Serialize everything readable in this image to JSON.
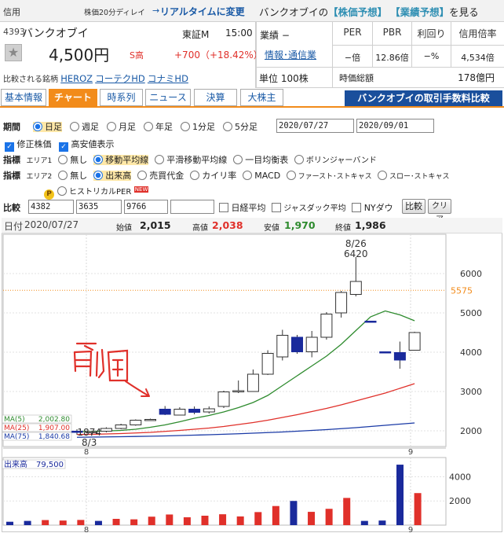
{
  "topbar": {
    "credit_label": "信用",
    "delay_text": "株価20分ディレイ",
    "arrow": "→",
    "realtime_link": "リアルタイムに変更",
    "predict_prefix": "バンクオブイの",
    "stock_forecast": "【株価予想】",
    "earnings_forecast": "【業績予想】",
    "predict_suffix": "を見る"
  },
  "stock": {
    "code": "4393",
    "name": "バンクオブイ",
    "market": "東証M",
    "time": "15:00",
    "price": "4,500円",
    "s_high": "S高",
    "change": "+700（+18.42%）",
    "star_icon": "★",
    "sector_label": "業績 −",
    "sector_link": "情報･通信業",
    "unit": "単位 100株",
    "compare_label": "比較される銘柄",
    "compare_links": [
      "HEROZ",
      "コーテクHD",
      "コナミHD"
    ]
  },
  "metrics": {
    "headers": [
      "PER",
      "PBR",
      "利回り",
      "信用倍率"
    ],
    "values": [
      "−倍",
      "12.86倍",
      "−%",
      "4,534倍"
    ],
    "mcap_label": "時価総額",
    "mcap_value": "178億円"
  },
  "tabs": [
    "基本情報",
    "チャート",
    "時系列",
    "ニュース",
    "決算",
    "大株主"
  ],
  "fee_banner": "バンクオブイの取引手数料比較",
  "controls": {
    "period_label": "期間",
    "periods": [
      "日足",
      "週足",
      "月足",
      "年足",
      "1分足",
      "5分足"
    ],
    "date_from": "2020/07/27",
    "date_to": "2020/09/01",
    "adj_price": "修正株価",
    "high_low": "高安値表示",
    "indicator_label": "指標",
    "area1_label": "エリア1",
    "area1_options": [
      "無し",
      "移動平均線",
      "平滑移動平均線",
      "一目均衡表",
      "ボリンジャーバンド"
    ],
    "area2_label": "エリア2",
    "area2_options": [
      "無し",
      "出来高",
      "売買代金",
      "カイリ率",
      "MACD",
      "ファースト･ストキャス",
      "スロー･ストキャス"
    ],
    "historical_per": "ヒストリカルPER",
    "new_badge": "NEW",
    "p_badge": "P",
    "compare_label": "比較",
    "compare_codes": [
      "4382",
      "3635",
      "9766",
      ""
    ],
    "nikkei": "日経平均",
    "jasdaq": "ジャスダック平均",
    "ny_dow": "NYダウ",
    "compare_btn": "比較",
    "clear_btn": "クリア"
  },
  "chart_info": {
    "date_label": "日付",
    "date": "2020/07/27",
    "open_label": "始値",
    "open": "2,015",
    "high_label": "高値",
    "high": "2,038",
    "low_label": "安値",
    "low": "1,970",
    "close_label": "終値",
    "close": "1,986"
  },
  "chart_data": {
    "type": "candlestick",
    "x_ticks": [
      "8",
      "9"
    ],
    "price_ticks": [
      2000,
      3000,
      4000,
      5000,
      6000
    ],
    "price_range": [
      1600,
      7000
    ],
    "current_price": 5575,
    "high_annotation": {
      "date": "8/26",
      "value": 6420
    },
    "low_annotation": {
      "date": "8/3",
      "value": 1874
    },
    "candles": [
      {
        "o": 1990,
        "h": 2040,
        "l": 1900,
        "c": 1960
      },
      {
        "o": 1960,
        "h": 2000,
        "l": 1874,
        "c": 1980
      },
      {
        "o": 1990,
        "h": 2090,
        "l": 1960,
        "c": 2060
      },
      {
        "o": 2060,
        "h": 2180,
        "l": 2040,
        "c": 2150
      },
      {
        "o": 2150,
        "h": 2290,
        "l": 2130,
        "c": 2270
      },
      {
        "o": 2280,
        "h": 2310,
        "l": 2270,
        "c": 2290
      },
      {
        "o": 2550,
        "h": 2630,
        "l": 2400,
        "c": 2420
      },
      {
        "o": 2400,
        "h": 2600,
        "l": 2400,
        "c": 2550
      },
      {
        "o": 2550,
        "h": 2620,
        "l": 2420,
        "c": 2470
      },
      {
        "o": 2480,
        "h": 2620,
        "l": 2440,
        "c": 2560
      },
      {
        "o": 2620,
        "h": 3020,
        "l": 2580,
        "c": 2990
      },
      {
        "o": 2990,
        "h": 3280,
        "l": 2960,
        "c": 3020
      },
      {
        "o": 3000,
        "h": 3560,
        "l": 2990,
        "c": 3440
      },
      {
        "o": 3440,
        "h": 4050,
        "l": 3420,
        "c": 3970
      },
      {
        "o": 3880,
        "h": 4570,
        "l": 3790,
        "c": 4430
      },
      {
        "o": 4380,
        "h": 4440,
        "l": 3960,
        "c": 4010
      },
      {
        "o": 4010,
        "h": 4540,
        "l": 3870,
        "c": 4380
      },
      {
        "o": 4380,
        "h": 5020,
        "l": 4320,
        "c": 4970
      },
      {
        "o": 5000,
        "h": 5560,
        "l": 4880,
        "c": 5520
      },
      {
        "o": 5470,
        "h": 6420,
        "l": 5420,
        "c": 5800
      },
      {
        "o": 4790,
        "h": 4800,
        "l": 4760,
        "c": 4780
      },
      {
        "o": 4010,
        "h": 4020,
        "l": 3990,
        "c": 4000
      },
      {
        "o": 3990,
        "h": 4270,
        "l": 3580,
        "c": 3800
      },
      {
        "o": 4050,
        "h": 4520,
        "l": 4050,
        "c": 4500
      }
    ],
    "ma": [
      {
        "name": "MA(5)",
        "value": "2,002.80",
        "color": "#2e8b2e",
        "values": [
          1980,
          1985,
          1995,
          2010,
          2040,
          2090,
          2150,
          2230,
          2320,
          2390,
          2480,
          2590,
          2720,
          2900,
          3150,
          3400,
          3650,
          3900,
          4200,
          4550,
          4900,
          5050,
          4950,
          4800
        ]
      },
      {
        "name": "MA(25)",
        "value": "1,907.00",
        "color": "#e0302a",
        "values": [
          1905,
          1910,
          1920,
          1930,
          1945,
          1960,
          1985,
          2010,
          2040,
          2070,
          2110,
          2160,
          2210,
          2270,
          2340,
          2410,
          2490,
          2570,
          2660,
          2760,
          2860,
          2960,
          3080,
          3200
        ]
      },
      {
        "name": "MA(75)",
        "value": "1,840.68",
        "color": "#1a3aa6",
        "values": [
          1835,
          1840,
          1845,
          1850,
          1856,
          1862,
          1870,
          1880,
          1890,
          1900,
          1912,
          1925,
          1940,
          1955,
          1970,
          1990,
          2010,
          2030,
          2055,
          2080,
          2110,
          2140,
          2170,
          2200
        ]
      }
    ],
    "volume_label": "出来高",
    "volume_value": "79,500",
    "volume_ticks": [
      2000,
      4000
    ],
    "volume_max": 5200,
    "volume": [
      {
        "v": 280,
        "up": false
      },
      {
        "v": 350,
        "up": false
      },
      {
        "v": 420,
        "up": true
      },
      {
        "v": 380,
        "up": true
      },
      {
        "v": 430,
        "up": true
      },
      {
        "v": 350,
        "up": false
      },
      {
        "v": 520,
        "up": true
      },
      {
        "v": 480,
        "up": true
      },
      {
        "v": 700,
        "up": true
      },
      {
        "v": 880,
        "up": true
      },
      {
        "v": 650,
        "up": true
      },
      {
        "v": 780,
        "up": true
      },
      {
        "v": 900,
        "up": true
      },
      {
        "v": 720,
        "up": true
      },
      {
        "v": 1080,
        "up": true
      },
      {
        "v": 1580,
        "up": true
      },
      {
        "v": 2000,
        "up": false
      },
      {
        "v": 1100,
        "up": true
      },
      {
        "v": 1350,
        "up": true
      },
      {
        "v": 2250,
        "up": true
      },
      {
        "v": 350,
        "up": false
      },
      {
        "v": 380,
        "up": false
      },
      {
        "v": 5000,
        "up": false
      },
      {
        "v": 2650,
        "up": true
      }
    ],
    "handwritten_annotation": "前回"
  }
}
